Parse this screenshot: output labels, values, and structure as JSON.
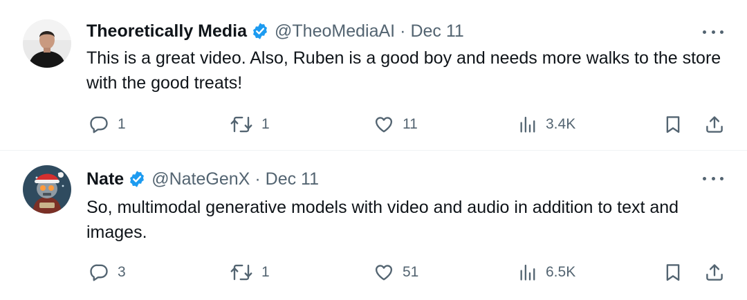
{
  "tweets": [
    {
      "display_name": "Theoretically Media",
      "handle": "@TheoMediaAI",
      "separator": "·",
      "date": "Dec 11",
      "text": "This is a great video. Also, Ruben is a good boy and needs more walks to the store with the good treats!",
      "avatar": "profile-photo-man-black-shirt",
      "stats": {
        "replies": "1",
        "reposts": "1",
        "likes": "11",
        "views": "3.4K"
      }
    },
    {
      "display_name": "Nate",
      "handle": "@NateGenX",
      "separator": "·",
      "date": "Dec 11",
      "text": "So, multimodal generative models with video and audio in addition to text and images.",
      "avatar": "profile-illustration-robot-santa-hat",
      "stats": {
        "replies": "3",
        "reposts": "1",
        "likes": "51",
        "views": "6.5K"
      }
    }
  ],
  "icons": {
    "verified": "verified-badge-icon",
    "more": "more-options-icon",
    "reply": "reply-icon",
    "repost": "repost-icon",
    "like": "heart-icon",
    "views": "views-icon",
    "bookmark": "bookmark-icon",
    "share": "share-icon"
  },
  "colors": {
    "verified_blue": "#1d9bf0",
    "secondary_text": "#536471",
    "primary_text": "#0f1419",
    "divider": "#eff3f4"
  }
}
